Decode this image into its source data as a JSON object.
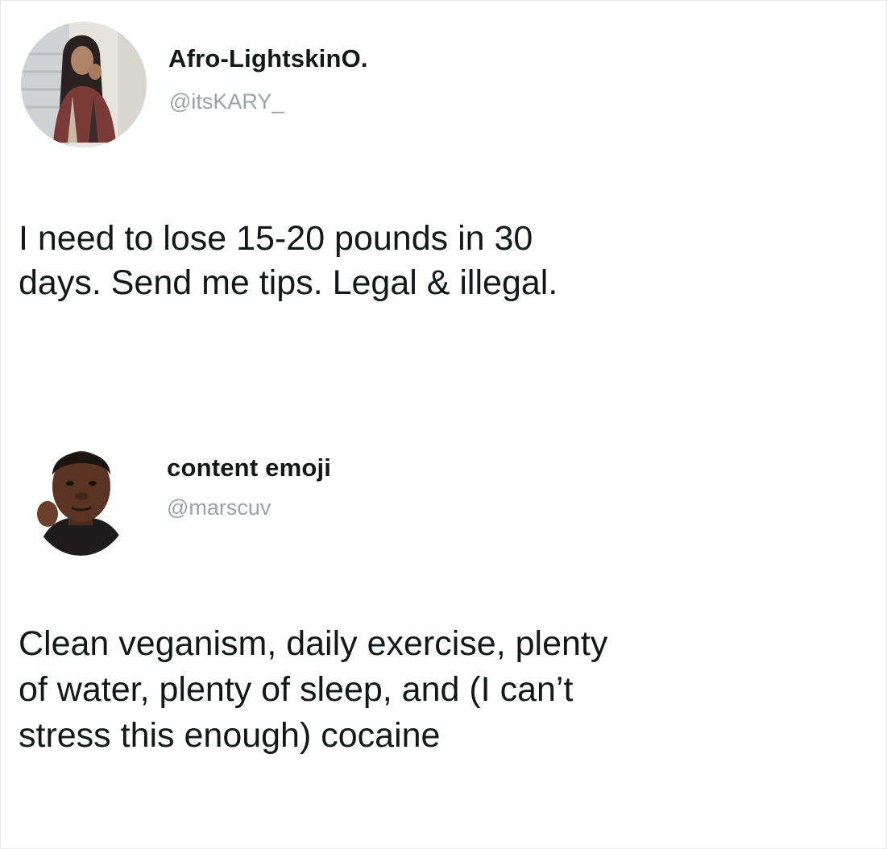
{
  "tweets": [
    {
      "display_name": "Afro-LightskinO.",
      "handle": "@itsKARY_",
      "text": "I need to lose 15-20 pounds in 30\ndays. Send me tips. Legal & illegal."
    },
    {
      "display_name": "content emoji",
      "handle": "@marscuv",
      "text": "Clean veganism, daily exercise, plenty\nof water, plenty of sleep, and (I can’t\nstress this enough) cocaine"
    }
  ]
}
